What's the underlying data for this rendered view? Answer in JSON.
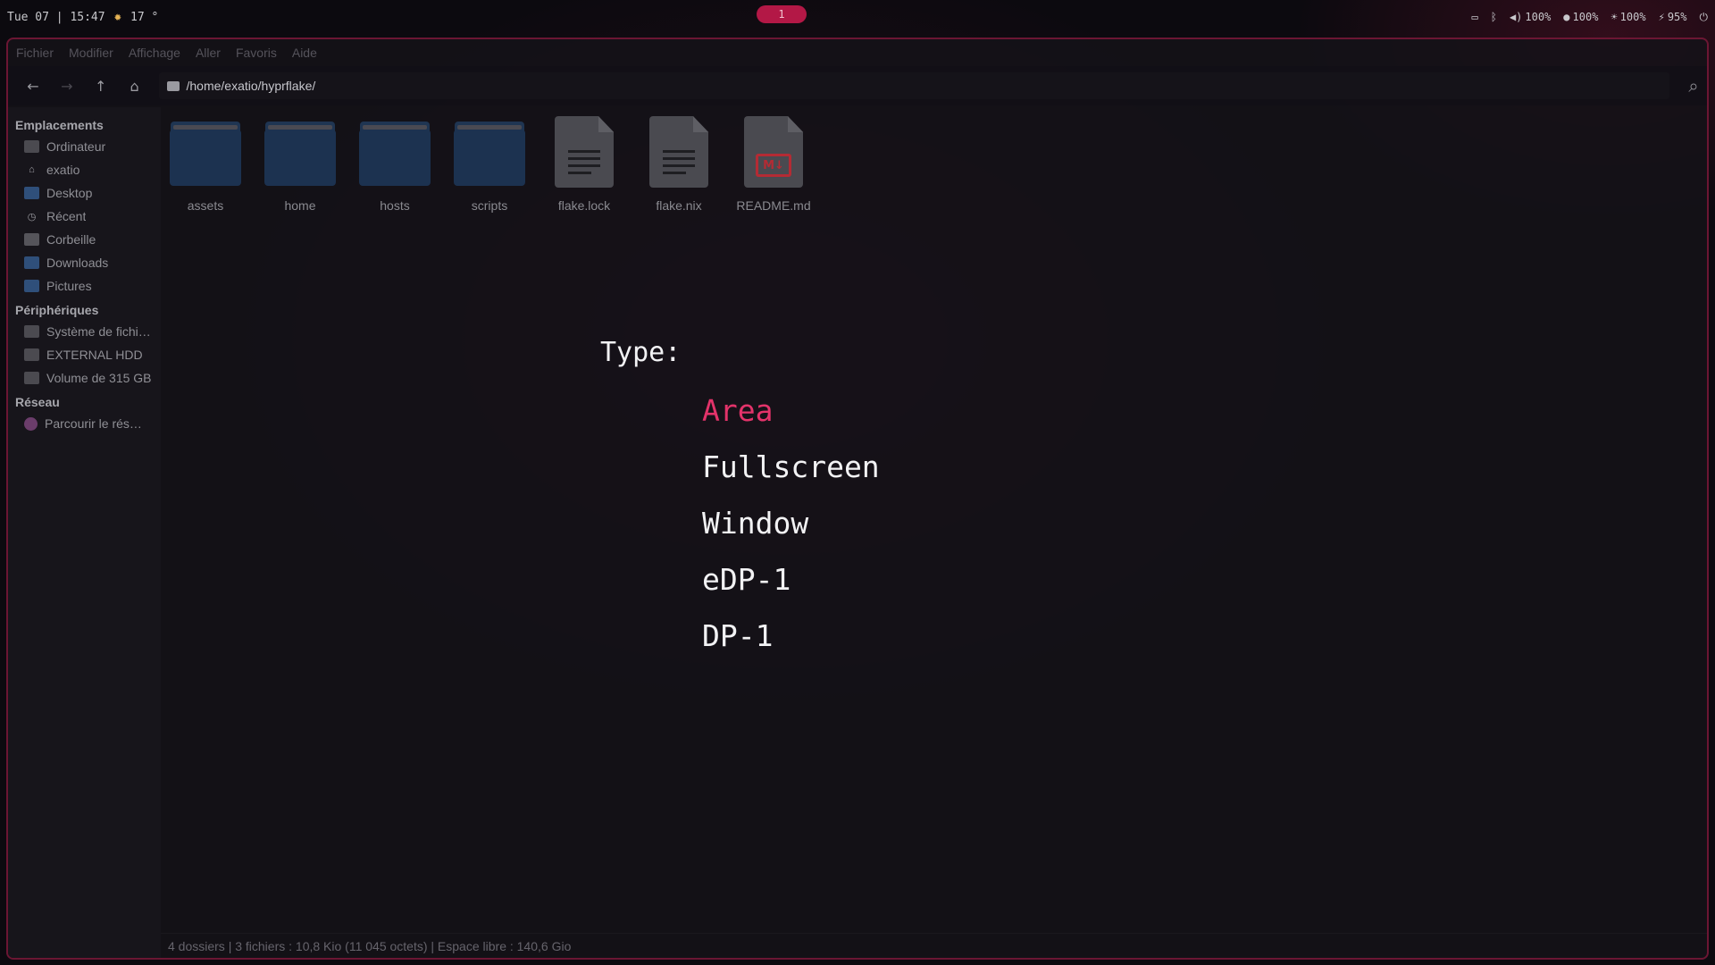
{
  "topbar": {
    "datetime": "Tue 07 | 15:47",
    "weather_icon": "sun-icon",
    "temperature": "17 °",
    "workspace": "1",
    "volume": "100%",
    "mic": "100%",
    "brightness": "100%",
    "battery": "95%"
  },
  "menubar": [
    "Fichier",
    "Modifier",
    "Affichage",
    "Aller",
    "Favoris",
    "Aide"
  ],
  "path": "/home/exatio/hyprflake/",
  "sidebar": {
    "places_header": "Emplacements",
    "places": [
      {
        "label": "Ordinateur",
        "icon": "computer-icon"
      },
      {
        "label": "exatio",
        "icon": "home-icon"
      },
      {
        "label": "Desktop",
        "icon": "desktop-icon"
      },
      {
        "label": "Récent",
        "icon": "clock-icon"
      },
      {
        "label": "Corbeille",
        "icon": "trash-icon"
      },
      {
        "label": "Downloads",
        "icon": "downloads-icon"
      },
      {
        "label": "Pictures",
        "icon": "pictures-icon"
      }
    ],
    "devices_header": "Périphériques",
    "devices": [
      {
        "label": "Système de fichi…",
        "icon": "drive-icon"
      },
      {
        "label": "EXTERNAL HDD",
        "icon": "drive-icon"
      },
      {
        "label": "Volume de 315 GB",
        "icon": "drive-icon"
      }
    ],
    "network_header": "Réseau",
    "network": [
      {
        "label": "Parcourir le rés…",
        "icon": "network-icon"
      }
    ]
  },
  "files": [
    {
      "name": "assets",
      "type": "folder"
    },
    {
      "name": "home",
      "type": "folder"
    },
    {
      "name": "hosts",
      "type": "folder"
    },
    {
      "name": "scripts",
      "type": "folder"
    },
    {
      "name": "flake.lock",
      "type": "text"
    },
    {
      "name": "flake.nix",
      "type": "text"
    },
    {
      "name": "README.md",
      "type": "markdown"
    }
  ],
  "markdown_badge": "M↓",
  "screenshot_menu": {
    "prompt": "Type:",
    "options": [
      "Area",
      "Fullscreen",
      "Window",
      "eDP-1",
      "DP-1"
    ],
    "selected_color": "#e3336a"
  },
  "status": "4 dossiers  |  3 fichiers : 10,8 Kio (11 045 octets)  |  Espace libre : 140,6 Gio"
}
